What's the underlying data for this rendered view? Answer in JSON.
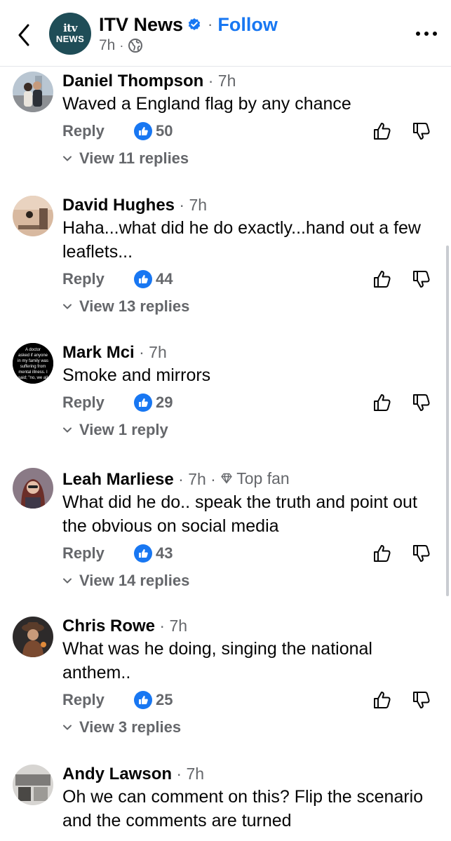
{
  "header": {
    "page_name": "ITV News",
    "follow_label": "Follow",
    "time": "7h",
    "avatar_top": "itv",
    "avatar_bottom": "NEWS"
  },
  "comments": [
    {
      "author": "Daniel Thompson",
      "time": "7h",
      "text": "Waved a England flag by any chance",
      "reply_label": "Reply",
      "likes": "50",
      "view_replies": "View 11 replies"
    },
    {
      "author": "David Hughes",
      "time": "7h",
      "text": "Haha...what did he do exactly...hand out a few leaflets...",
      "reply_label": "Reply",
      "likes": "44",
      "view_replies": "View 13 replies"
    },
    {
      "author": "Mark Mci",
      "time": "7h",
      "text": "Smoke and mirrors",
      "reply_label": "Reply",
      "likes": "29",
      "view_replies": "View 1 reply",
      "avatar_text": "A doctor asked if anyone in my family was suffering from mental illness. I said; \"no, we all seem to enjoy it\""
    },
    {
      "author": "Leah Marliese",
      "time": "7h",
      "badge": "Top fan",
      "text": "What did he do.. speak the truth and point out the obvious on social media",
      "reply_label": "Reply",
      "likes": "43",
      "view_replies": "View 14 replies"
    },
    {
      "author": "Chris Rowe",
      "time": "7h",
      "text": "What was he doing, singing the national anthem..",
      "reply_label": "Reply",
      "likes": "25",
      "view_replies": "View 3 replies"
    },
    {
      "author": "Andy Lawson",
      "time": "7h",
      "text": "Oh we can comment on this? Flip the scenario and the comments are turned"
    }
  ],
  "colors": {
    "accent": "#1877f2",
    "secondary_text": "#65676b",
    "primary_text": "#050505",
    "page_avatar_bg": "#1f4d57"
  },
  "icons": [
    "back-chevron-icon",
    "verified-badge-icon",
    "globe-icon",
    "more-options-icon",
    "like-icon",
    "thumbs-up-icon",
    "thumbs-down-icon",
    "chevron-down-icon",
    "diamond-icon"
  ]
}
